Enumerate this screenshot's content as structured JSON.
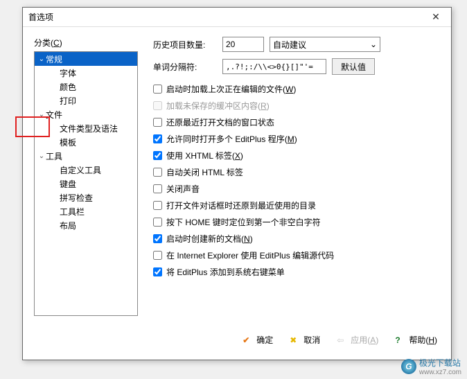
{
  "title": "首选项",
  "category_label": "分类",
  "category_accel": "C",
  "tree": {
    "general": "常规",
    "font": "字体",
    "color": "颜色",
    "print": "打印",
    "file": "文件",
    "filetype": "文件类型及语法",
    "template": "模板",
    "tools": "工具",
    "custom_tools": "自定义工具",
    "keyboard": "键盘",
    "spell": "拼写检查",
    "toolbar": "工具栏",
    "layout": "布局"
  },
  "rows": {
    "history_label": "历史项目数量:",
    "history_value": "20",
    "suggestion": "自动建议",
    "delimiter_label": "单词分隔符:",
    "delimiter_value": ",.?!;:/\\\\<>0{}[]\"'=",
    "default_btn": "默认值"
  },
  "checks": {
    "c1": "启动时加载上次正在编辑的文件",
    "c1_accel": "W",
    "c2": "加载未保存的缓冲区内容",
    "c2_accel": "R",
    "c3": "还原最近打开文档的窗口状态",
    "c4": "允许同时打开多个 EditPlus 程序",
    "c4_accel": "M",
    "c5": "使用 XHTML 标签",
    "c5_accel": "X",
    "c6": "自动关闭 HTML 标签",
    "c7": "关闭声音",
    "c8": "打开文件对话框时还原到最近使用的目录",
    "c9": "按下 HOME 键时定位到第一个非空白字符",
    "c10": "启动时创建新的文档",
    "c10_accel": "N",
    "c11": "在 Internet Explorer 使用 EditPlus 编辑源代码",
    "c12": "将 EditPlus 添加到系统右键菜单"
  },
  "buttons": {
    "ok": "确定",
    "cancel": "取消",
    "apply": "应用",
    "apply_accel": "A",
    "help": "帮助",
    "help_accel": "H"
  },
  "watermark": {
    "name": "极光下载站",
    "url": "www.xz7.com"
  }
}
